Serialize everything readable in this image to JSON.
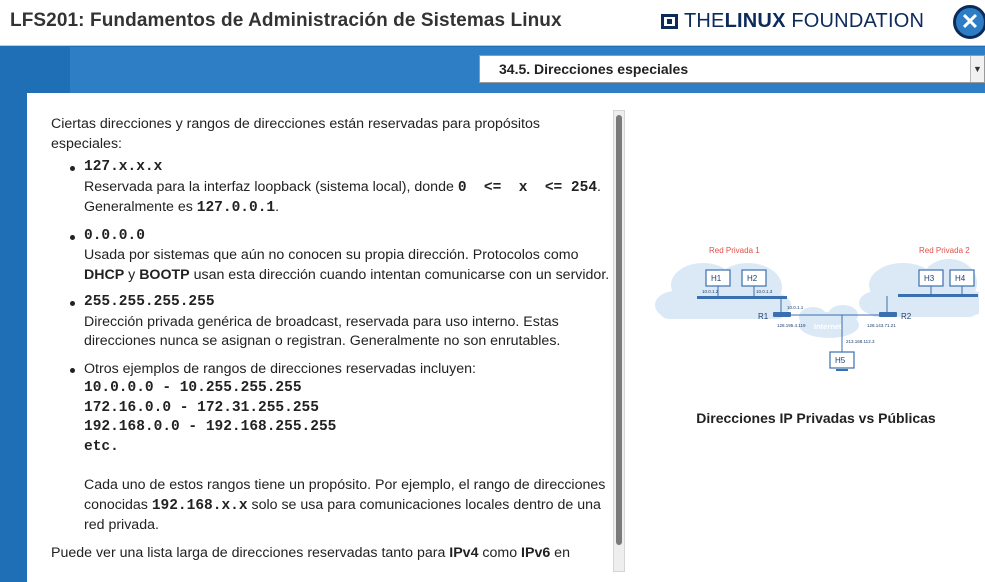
{
  "header": {
    "course_title": "LFS201: Fundamentos de Administración de Sistemas Linux",
    "logo_prefix": "THE",
    "logo_bold": "LINUX",
    "logo_suffix": " FOUNDATION",
    "close_glyph": "✕"
  },
  "nav": {
    "section_label": "34.5. Direcciones especiales",
    "arrow": "▼"
  },
  "main": {
    "intro": "Ciertas direcciones y rangos de direcciones están reservadas para propósitos especiales:",
    "item1": {
      "code": "127.x.x.x",
      "desc_a": "Reservada para la interfaz loopback (sistema local), donde ",
      "desc_code": "0  <=  x  <= 254",
      "desc_b": ". Generalmente es ",
      "desc_code2": "127.0.0.1",
      "desc_c": "."
    },
    "item2": {
      "code": "0.0.0.0",
      "desc_a": "Usada por sistemas que aún no conocen su propia dirección. Protocolos como ",
      "dhcp": "DHCP",
      "desc_b": " y ",
      "bootp": "BOOTP",
      "desc_c": " usan esta dirección cuando intentan comunicarse con un servidor."
    },
    "item3": {
      "code": "255.255.255.255",
      "desc": "Dirección privada genérica de broadcast, reservada para uso interno. Estas direcciones nunca se asignan o registran. Generalmente no son enrutables."
    },
    "item4": {
      "intro": "Otros ejemplos de rangos de direcciones reservadas incluyen:",
      "ranges": [
        "10.0.0.0 - 10.255.255.255",
        "172.16.0.0 - 172.31.255.255",
        "192.168.0.0 - 192.168.255.255",
        "etc."
      ],
      "note_a": "Cada uno de estos rangos tiene un propósito. Por ejemplo, el rango de direcciones conocidas ",
      "note_code": "192.168.x.x",
      "note_b": " solo se usa para comunicaciones locales dentro de una red privada."
    },
    "outro_a": "Puede ver una lista larga de direcciones reservadas tanto para ",
    "ipv4": "IPv4",
    "outro_b": " como ",
    "ipv6": "IPv6",
    "outro_c": " en"
  },
  "figure": {
    "caption": "Direcciones IP Privadas vs Públicas",
    "net1_label": "Red Privada 1",
    "net2_label": "Red Privada 2",
    "internet_label": "Internet",
    "hosts": [
      "H1",
      "H2",
      "H3",
      "H4",
      "H5"
    ],
    "routers": [
      "R1",
      "R2"
    ],
    "addr_h1": "10.0.1.2",
    "addr_h2": "10.0.1.3",
    "addr_r1_in": "10.0.1.1",
    "addr_r1_out": "128.195.4.119",
    "addr_r2": "128.143.71.21",
    "addr_h5": "213.168.112.3",
    "colors": {
      "label_red": "#e0504a",
      "cloud": "#dbe9f6",
      "device": "#3a6fb0",
      "internet_text": "#ffffff"
    }
  }
}
